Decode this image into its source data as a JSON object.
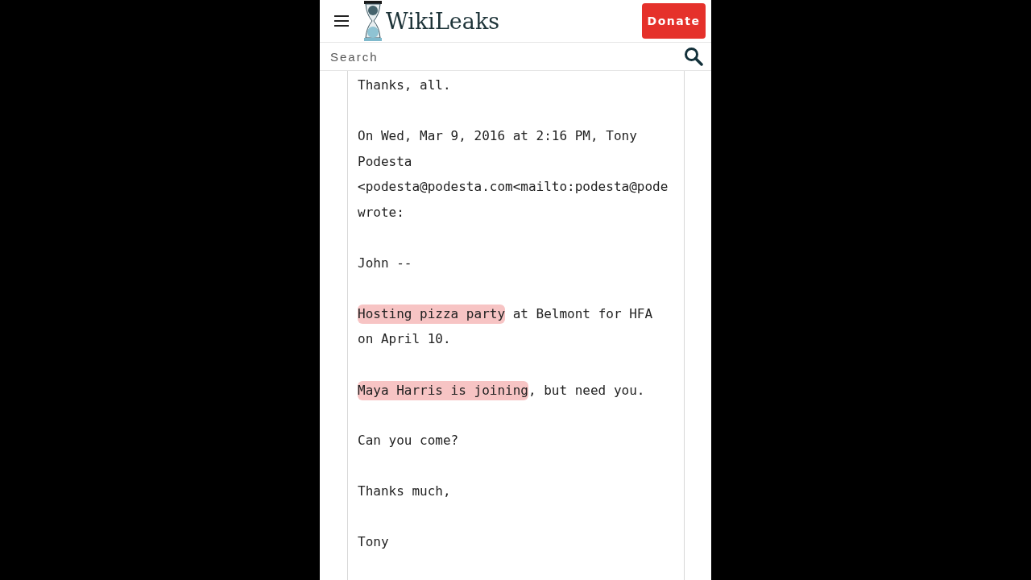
{
  "header": {
    "logo_text": "WikiLeaks",
    "donate_button": "Donate"
  },
  "search": {
    "placeholder": "Search"
  },
  "email": {
    "paragraphs": [
      {
        "lines": [
          "Thanks, all."
        ]
      },
      {
        "lines": [
          "On Wed, Mar 9, 2016 at 2:16 PM, Tony",
          "Podesta",
          "<podesta@podesta.com<mailto:podesta@pode",
          "wrote:"
        ]
      },
      {
        "lines": [
          "John --"
        ]
      },
      {
        "lines": [
          [
            {
              "text": "Hosting pizza party",
              "highlighted": true
            },
            {
              "text": " at Belmont for HFA",
              "highlighted": false
            }
          ],
          "on April 10."
        ]
      },
      {
        "lines": [
          [
            {
              "text": "Maya Harris is joining",
              "highlighted": true
            },
            {
              "text": ", but need you.",
              "highlighted": false
            }
          ]
        ]
      },
      {
        "lines": [
          "Can you come?"
        ]
      },
      {
        "lines": [
          "Thanks much,"
        ]
      },
      {
        "lines": [
          "Tony"
        ]
      }
    ]
  }
}
